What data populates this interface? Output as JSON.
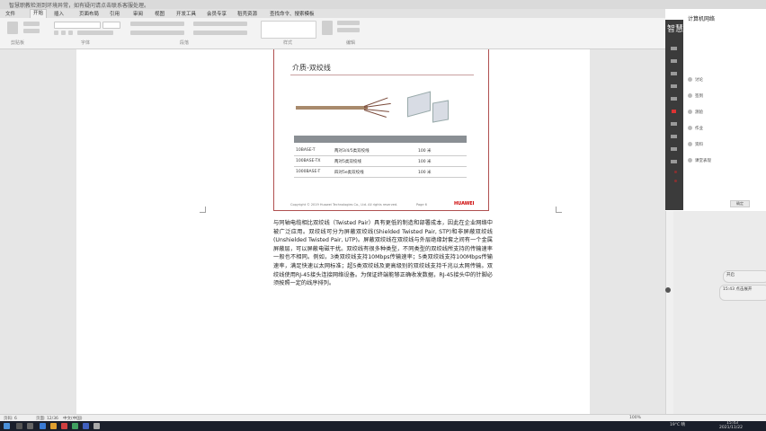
{
  "titlebar": {
    "message": "智慧职教检测到环境异常，如有疑问请点击联系客服处理。"
  },
  "tabs": [
    "文件",
    "开始",
    "插入",
    "页面布局",
    "引用",
    "审阅",
    "视图",
    "开发工具",
    "会员专享",
    "稻壳资源",
    "查找命令、搜索模板"
  ],
  "ribbon_groups": [
    "剪贴板",
    "字体",
    "段落",
    "样式",
    "编辑"
  ],
  "slide": {
    "title": "介质-双绞线",
    "table": [
      {
        "type": "10BASE-T",
        "desc": "两对3/4/5类双绞线",
        "dist": "100 米"
      },
      {
        "type": "100BASE-TX",
        "desc": "两对5类双绞线",
        "dist": "100 米"
      },
      {
        "type": "1000BASE-T",
        "desc": "四对5e类双绞线",
        "dist": "100 米"
      }
    ],
    "footer": "Copyright © 2019 Huawei Technologies Co., Ltd. All rights reserved.",
    "page": "Page 6",
    "logo": "HUAWEI"
  },
  "paragraph": "与同轴电缆相比双绞线（Twisted Pair）具有更低的制造和部署成本，因此在企业网络中被广泛应用。双绞线可分为屏蔽双绞线(Shielded Twisted Pair, STP)和非屏蔽双绞线(Unshielded Twisted Pair, UTP)。屏蔽双绞线在双绞线与外层绝缘封套之间有一个金属屏蔽层，可以屏蔽电磁干扰。双绞线有很多种类型，不同类型的双绞线所支持的传输速率一般也不相同。例如，3类双绞线支持10Mbps传输速率；5类双绞线支持100Mbps传输速率，满足快速以太网标准；超5类双绞线及更高级别的双绞线支持千兆以太网传输。双绞线使用RJ-45接头连接网络设备。为保证终端能够正确收发数据，RJ-45接头中的针脚必须按照一定的线序排列。",
  "side_panel": {
    "brand": "智慧",
    "course": "计算机网络",
    "items": [
      "讨论",
      "签到",
      "测验",
      "作业",
      "资料",
      "课堂表现"
    ],
    "button": "确定"
  },
  "float_pills": [
    "开启",
    "15:43 点击展开"
  ],
  "status": {
    "page": "页码: 6",
    "pages": "页面: 12/36",
    "lang": "中文(中国)",
    "zoom": "100%"
  },
  "tray": {
    "temp": "19°C 晴",
    "time": "15:43",
    "date": "2021/11/22"
  }
}
